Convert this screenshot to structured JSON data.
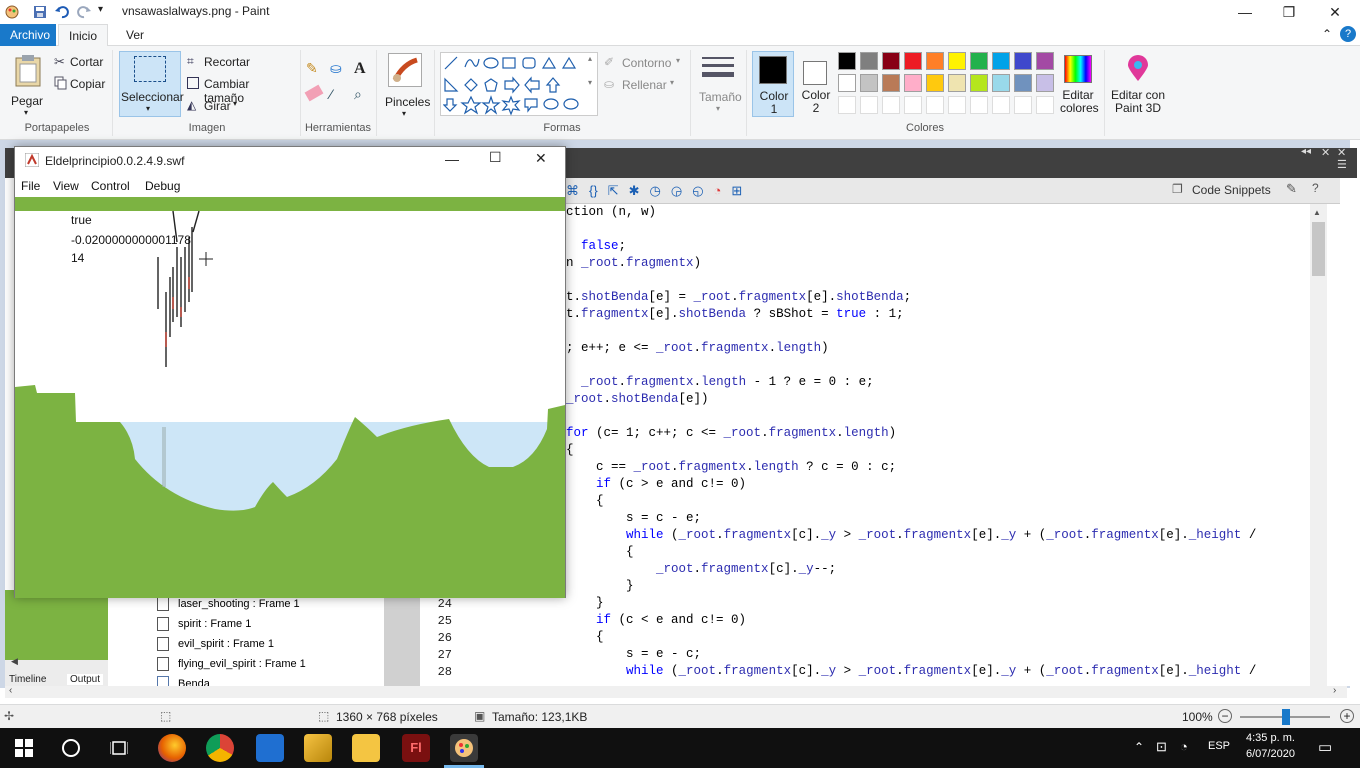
{
  "window": {
    "title": "vnsawaslalways.png - Paint"
  },
  "ribbon": {
    "tabs": [
      "Archivo",
      "Inicio",
      "Ver"
    ],
    "clipboard": {
      "paste": "Pegar",
      "cut": "Cortar",
      "copy": "Copiar",
      "group": "Portapapeles"
    },
    "image": {
      "select": "Seleccionar",
      "crop": "Recortar",
      "resize": "Cambiar tamaño",
      "rotate": "Girar",
      "group": "Imagen"
    },
    "tools": {
      "group": "Herramientas"
    },
    "brushes": {
      "label": "Pinceles"
    },
    "shapes": {
      "outline": "Contorno",
      "fill": "Rellenar",
      "group": "Formas"
    },
    "size": {
      "label": "Tamaño"
    },
    "colors": {
      "color1": "Color 1",
      "color2": "Color 2",
      "edit": "Editar colores",
      "paint3d": "Editar con Paint 3D",
      "group": "Colores",
      "palette_row1": [
        "#000000",
        "#7f7f7f",
        "#880015",
        "#ed1c24",
        "#ff7f27",
        "#fff200",
        "#22b14c",
        "#00a2e8",
        "#3f48cc",
        "#a349a4"
      ],
      "palette_row2": [
        "#ffffff",
        "#c3c3c3",
        "#b97a57",
        "#ffaec9",
        "#ffc90e",
        "#efe4b0",
        "#b5e61d",
        "#99d9ea",
        "#7092be",
        "#c8bfe7"
      ]
    }
  },
  "swf": {
    "title": "Eldelprincipio0.0.2.4.9.swf",
    "menu": [
      "File",
      "View",
      "Control",
      "Debug"
    ],
    "debug_lines": [
      "true",
      "-0.0200000000001178",
      "14"
    ]
  },
  "ide": {
    "code_snippets": "Code Snippets",
    "code_lines": [
      {
        "text": "ction (n, w)"
      },
      {
        "text": ""
      },
      {
        "text": "  false;"
      },
      {
        "text": "n _root.fragmentx)"
      },
      {
        "text": ""
      },
      {
        "text": "t.shotBenda[e] = _root.fragmentx[e].shotBenda;"
      },
      {
        "text": "t.fragmentx[e].shotBenda ? sBShot = true : 1;"
      },
      {
        "text": ""
      },
      {
        "text": "; e++; e <= _root.fragmentx.length)"
      },
      {
        "text": ""
      },
      {
        "text": "  _root.fragmentx.length - 1 ? e = 0 : e;"
      },
      {
        "text": "_root.shotBenda[e])"
      },
      {
        "text": ""
      },
      {
        "text": "for (c= 1; c++; c <= _root.fragmentx.length)"
      },
      {
        "text": "{"
      },
      {
        "text": "    c == _root.fragmentx.length ? c = 0 : c;"
      },
      {
        "text": "    if (c > e and c!= 0)"
      },
      {
        "text": "    {"
      },
      {
        "text": "        s = c - e;"
      },
      {
        "text": "        while (_root.fragmentx[c]._y > _root.fragmentx[e]._y + (_root.fragmentx[e]._height /"
      },
      {
        "text": "        {"
      },
      {
        "text": "            _root.fragmentx[c]._y--;"
      },
      {
        "text": "        }"
      },
      {
        "text": "    }"
      },
      {
        "text": "    if (c < e and c!= 0)"
      },
      {
        "text": "    {"
      },
      {
        "text": "        s = e - c;"
      },
      {
        "text": "        while (_root.fragmentx[c]._y > _root.fragmentx[e]._y + (_root.fragmentx[e]._height /"
      }
    ],
    "line_numbers": [
      "24",
      "25",
      "26",
      "27",
      "28"
    ],
    "library_items": [
      "laser_shooting : Frame 1",
      "spirit : Frame 1",
      "evil_spirit : Frame 1",
      "flying_evil_spirit : Frame 1",
      "Benda"
    ],
    "panel_tabs": [
      "Timeline",
      "Output"
    ]
  },
  "status": {
    "dimensions": "1360 × 768 píxeles",
    "size": "Tamaño: 123,1KB",
    "zoom": "100%"
  },
  "taskbar": {
    "lang": "ESP",
    "time": "4:35 p. m.",
    "date": "6/07/2020"
  }
}
